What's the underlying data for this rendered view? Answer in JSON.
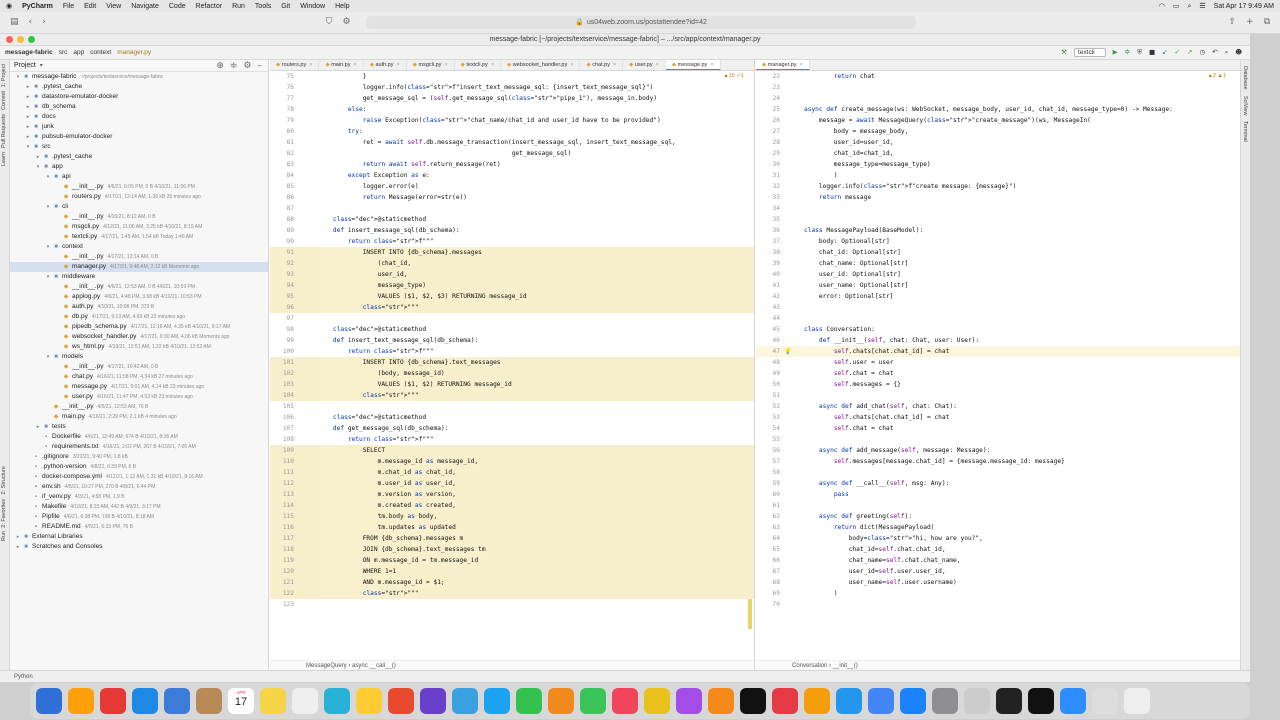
{
  "macmenu": {
    "app": "PyCharm",
    "items": [
      "File",
      "Edit",
      "View",
      "Navigate",
      "Code",
      "Refactor",
      "Run",
      "Tools",
      "Git",
      "Window",
      "Help"
    ],
    "datetime": "Sat Apr 17  9:49 AM"
  },
  "browser": {
    "url": "us04web.zoom.us/postattendee?id=42"
  },
  "ide": {
    "title": "message-fabric [~/projects/textservice/message-fabric] – .../src/app/context/manager.py",
    "nav": [
      "message-fabric",
      "src",
      "app",
      "context",
      "manager.py"
    ],
    "run_config": "textcli"
  },
  "left_strip": [
    "1: Project",
    "Commit",
    "Pull Requests",
    "Learn"
  ],
  "left_strip_bottom": [
    "2: Structure",
    "2: Favorites",
    "Run"
  ],
  "right_strip": [
    "Database",
    "SciView",
    "Terminal"
  ],
  "project": {
    "header": "Project",
    "tree": [
      {
        "d": 0,
        "t": "dir",
        "open": true,
        "name": "message-fabric",
        "meta": "~/projects/textservice/message-fabric"
      },
      {
        "d": 1,
        "t": "dir",
        "name": ".pytest_cache"
      },
      {
        "d": 1,
        "t": "dir",
        "name": "datastore-emulator-docker"
      },
      {
        "d": 1,
        "t": "dir",
        "name": "db_schema"
      },
      {
        "d": 1,
        "t": "dir",
        "name": "docs"
      },
      {
        "d": 1,
        "t": "dir",
        "name": "junk"
      },
      {
        "d": 1,
        "t": "dir",
        "name": "pubsub-emulator-docker"
      },
      {
        "d": 1,
        "t": "dir",
        "open": true,
        "name": "src"
      },
      {
        "d": 2,
        "t": "dir",
        "name": ".pytest_cache"
      },
      {
        "d": 2,
        "t": "dir",
        "open": true,
        "name": "app"
      },
      {
        "d": 3,
        "t": "dir",
        "open": true,
        "name": "api"
      },
      {
        "d": 4,
        "t": "py",
        "name": "__init__.py",
        "meta": "4/6/21, 6:05 PM, 0 B 4/10/21, 11:06 PM"
      },
      {
        "d": 4,
        "t": "py",
        "name": "routers.py",
        "meta": "4/17/21, 12:14 AM, 1.36 kB 25 minutes ago"
      },
      {
        "d": 3,
        "t": "dir",
        "open": true,
        "name": "cli"
      },
      {
        "d": 4,
        "t": "py",
        "name": "__init__.py",
        "meta": "4/10/21, 8:12 AM, 0 B"
      },
      {
        "d": 4,
        "t": "py",
        "name": "msgcli.py",
        "meta": "4/12/21, 11:06 AM, 3.25 kB 4/10/21, 8:19 AM"
      },
      {
        "d": 4,
        "t": "py",
        "name": "textcli.py",
        "meta": "4/17/21, 1:45 AM, 1.54 kB Today 1:46 AM"
      },
      {
        "d": 3,
        "t": "dir",
        "open": true,
        "name": "context"
      },
      {
        "d": 4,
        "t": "py",
        "name": "__init__.py",
        "meta": "4/17/21, 12:14 AM, 0 B"
      },
      {
        "d": 4,
        "t": "py",
        "name": "manager.py",
        "meta": "4/17/21, 9:48 AM, 2.12 kB Moments ago",
        "sel": true
      },
      {
        "d": 3,
        "t": "dir",
        "open": true,
        "name": "middleware"
      },
      {
        "d": 4,
        "t": "py",
        "name": "__init__.py",
        "meta": "4/6/21, 12:53 AM, 0 B 4/6/21, 10:59 PM"
      },
      {
        "d": 4,
        "t": "py",
        "name": "applog.py",
        "meta": "4/6/21, 4:48 PM, 3.68 kB 4/10/21, 10:53 PM"
      },
      {
        "d": 4,
        "t": "py",
        "name": "auth.py",
        "meta": "4/10/21, 10:08 PM, 373 B"
      },
      {
        "d": 4,
        "t": "py",
        "name": "db.py",
        "meta": "4/17/21, 9:13 AM, 4.69 kB 23 minutes ago"
      },
      {
        "d": 4,
        "t": "py",
        "name": "pipedb_schema.py",
        "meta": "4/17/21, 12:16 AM, 4.35 kB 4/10/21, 9:17 AM"
      },
      {
        "d": 4,
        "t": "py",
        "name": "websocket_handler.py",
        "meta": "4/17/21, 9:30 AM, 4.06 kB Moments ago"
      },
      {
        "d": 4,
        "t": "py",
        "name": "ws_html.py",
        "meta": "4/10/21, 12:51 AM, 1.22 kB 4/10/21, 12:52 AM"
      },
      {
        "d": 3,
        "t": "dir",
        "open": true,
        "name": "models"
      },
      {
        "d": 4,
        "t": "py",
        "name": "__init__.py",
        "meta": "4/17/21, 10:42 AM, 0 B"
      },
      {
        "d": 4,
        "t": "py",
        "name": "chat.py",
        "meta": "4/16/21, 11:58 PM, 4.34 kB 27 minutes ago"
      },
      {
        "d": 4,
        "t": "py",
        "name": "message.py",
        "meta": "4/17/21, 9:01 AM, 4.14 kB 23 minutes ago"
      },
      {
        "d": 4,
        "t": "py",
        "name": "user.py",
        "meta": "4/16/21, 11:47 PM, 4.53 kB 23 minutes ago"
      },
      {
        "d": 3,
        "t": "py",
        "name": "__init__.py",
        "meta": "4/5/21, 12:53 AM, 76 B"
      },
      {
        "d": 3,
        "t": "py",
        "name": "main.py",
        "meta": "4/16/21, 2:29 PM, 2.1 kB 4 minutes ago"
      },
      {
        "d": 2,
        "t": "dir",
        "name": "tests"
      },
      {
        "d": 2,
        "t": "gen",
        "name": "Dockerfile",
        "meta": "4/6/21, 12:49 AM, 674 B 4/10/21, 8:16 AM"
      },
      {
        "d": 2,
        "t": "gen",
        "name": "requirements.txt",
        "meta": "4/16/21, 2:02 PM, 267 B 4/10/21, 7:06 AM"
      },
      {
        "d": 1,
        "t": "gen",
        "name": ".gitignore",
        "meta": "3/22/21, 9:40 PM, 1.8 kB"
      },
      {
        "d": 1,
        "t": "gen",
        "name": ".python-version",
        "meta": "4/8/21, 6:39 PM, 6 B"
      },
      {
        "d": 1,
        "t": "gen",
        "name": "docker-compose.yml",
        "meta": "4/12/21, 1:12 AM, 1.31 kB 4/10/21, 8:16 AM"
      },
      {
        "d": 1,
        "t": "gen",
        "name": "env.sh",
        "meta": "4/5/21, 10:27 PM, 270 B 4/8/21, 6:44 PM"
      },
      {
        "d": 1,
        "t": "gen",
        "name": "if_venv.py",
        "meta": "4/3/21, 4:58 PM, 1.9 B"
      },
      {
        "d": 1,
        "t": "gen",
        "name": "Makefile",
        "meta": "4/10/21, 8:23 AM, 442 B 4/9/21, 3:17 PM"
      },
      {
        "d": 1,
        "t": "gen",
        "name": "Pipfile",
        "meta": "4/6/21, 6:38 PM, 198 B 4/10/21, 8:18 AM"
      },
      {
        "d": 1,
        "t": "gen",
        "name": "README.md",
        "meta": "4/5/21, 6:33 PM, 76 B"
      },
      {
        "d": 0,
        "t": "dir",
        "name": "External Libraries"
      },
      {
        "d": 0,
        "t": "dir",
        "name": "Scratches and Consoles"
      }
    ]
  },
  "editor_left": {
    "tabs": [
      "routers.py",
      "main.py",
      "auth.py",
      "msgcli.py",
      "textcli.py",
      "websocket_handler.py",
      "chat.py",
      "user.py",
      "message.py"
    ],
    "active_tab": 8,
    "inspection": "▲15 ✓1",
    "breadcrumb": "MessageQuery  ›  async __call__()",
    "lines": [
      {
        "n": 75,
        "c": "            }"
      },
      {
        "n": 76,
        "c": "            logger.info(f\"insert_text_message_sql: {insert_text_message_sql}\")"
      },
      {
        "n": 77,
        "c": "            get_message_sql = (self.get_message_sql(\"pipe_1\"), message_in.body)"
      },
      {
        "n": 78,
        "c": "        else:"
      },
      {
        "n": 79,
        "c": "            raise Exception(\"chat_name/chat_id and user_id have to be provided\")"
      },
      {
        "n": 80,
        "c": "        try:"
      },
      {
        "n": 81,
        "c": "            ret = await self.db.message_transaction(insert_message_sql, insert_text_message_sql,"
      },
      {
        "n": 82,
        "c": "                                                    get_message_sql)"
      },
      {
        "n": 83,
        "c": "            return await self.return_message(ret)"
      },
      {
        "n": 84,
        "c": "        except Exception as e:"
      },
      {
        "n": 85,
        "c": "            logger.error(e)"
      },
      {
        "n": 86,
        "c": "            return Message(error=str(e))"
      },
      {
        "n": 87,
        "c": ""
      },
      {
        "n": 88,
        "c": "    @staticmethod"
      },
      {
        "n": 89,
        "c": "    def insert_message_sql(db_schema):"
      },
      {
        "n": 90,
        "c": "        return f\"\"\""
      },
      {
        "n": 91,
        "c": "            INSERT INTO {db_schema}.messages",
        "h": 1
      },
      {
        "n": 92,
        "c": "                (chat_id,",
        "h": 1
      },
      {
        "n": 93,
        "c": "                user_id,",
        "h": 1
      },
      {
        "n": 94,
        "c": "                message_type)",
        "h": 1
      },
      {
        "n": 95,
        "c": "                VALUES ($1, $2, $3) RETURNING message_id",
        "h": 1
      },
      {
        "n": 96,
        "c": "            \"\"\"",
        "h": 1
      },
      {
        "n": 97,
        "c": ""
      },
      {
        "n": 98,
        "c": "    @staticmethod"
      },
      {
        "n": 99,
        "c": "    def insert_text_message_sql(db_schema):"
      },
      {
        "n": 100,
        "c": "        return f\"\"\""
      },
      {
        "n": 101,
        "c": "            INSERT INTO {db_schema}.text_messages",
        "h": 1
      },
      {
        "n": 102,
        "c": "                (body, message_id)",
        "h": 1
      },
      {
        "n": 103,
        "c": "                VALUES ($1, $2) RETURNING message_id",
        "h": 1
      },
      {
        "n": 104,
        "c": "            \"\"\"",
        "h": 1
      },
      {
        "n": 105,
        "c": ""
      },
      {
        "n": 106,
        "c": "    @staticmethod"
      },
      {
        "n": 107,
        "c": "    def get_message_sql(db_schema):"
      },
      {
        "n": 108,
        "c": "        return f\"\"\""
      },
      {
        "n": 109,
        "c": "            SELECT",
        "h": 1
      },
      {
        "n": 110,
        "c": "                m.message_id as message_id,",
        "h": 1
      },
      {
        "n": 111,
        "c": "                m.chat_id as chat_id,",
        "h": 1
      },
      {
        "n": 112,
        "c": "                m.user_id as user_id,",
        "h": 1
      },
      {
        "n": 113,
        "c": "                m.version as version,",
        "h": 1
      },
      {
        "n": 114,
        "c": "                m.created as created,",
        "h": 1
      },
      {
        "n": 115,
        "c": "                tm.body as body,",
        "h": 1
      },
      {
        "n": 116,
        "c": "                tm.updates as updated",
        "h": 1
      },
      {
        "n": 117,
        "c": "            FROM {db_schema}.messages m",
        "h": 1
      },
      {
        "n": 118,
        "c": "            JOIN {db_schema}.text_messages tm",
        "h": 1
      },
      {
        "n": 119,
        "c": "            ON m.message_id = tm.message_id",
        "h": 1
      },
      {
        "n": 120,
        "c": "            WHERE 1=1",
        "h": 1
      },
      {
        "n": 121,
        "c": "            AND m.message_id = $1;",
        "h": 1
      },
      {
        "n": 122,
        "c": "            \"\"\"",
        "h": 1
      },
      {
        "n": 123,
        "c": ""
      }
    ]
  },
  "editor_right": {
    "tabs": [
      "manager.py"
    ],
    "inspection": "▲2 ▲1",
    "breadcrumb": "Conversation  ›  __init__()",
    "lines": [
      {
        "n": 22,
        "c": "        return chat"
      },
      {
        "n": 23,
        "c": ""
      },
      {
        "n": 24,
        "c": ""
      },
      {
        "n": 25,
        "c": "async def create_message(ws: WebSocket, message_body, user_id, chat_id, message_type=0) -> Message:"
      },
      {
        "n": 26,
        "c": "    message = await MessageQuery(\"create_message\")(ws, MessageIn("
      },
      {
        "n": 27,
        "c": "        body = message_body,"
      },
      {
        "n": 28,
        "c": "        user_id=user_id,"
      },
      {
        "n": 29,
        "c": "        chat_id=chat_id,"
      },
      {
        "n": 30,
        "c": "        message_type=message_type)"
      },
      {
        "n": 31,
        "c": "        )"
      },
      {
        "n": 32,
        "c": "    logger.info(f\"create message: {message}\")"
      },
      {
        "n": 33,
        "c": "    return message"
      },
      {
        "n": 34,
        "c": ""
      },
      {
        "n": 35,
        "c": ""
      },
      {
        "n": 36,
        "c": "class MessagePayload(BaseModel):"
      },
      {
        "n": 37,
        "c": "    body: Optional[str]"
      },
      {
        "n": 38,
        "c": "    chat_id: Optional[str]"
      },
      {
        "n": 39,
        "c": "    chat_name: Optional[str]"
      },
      {
        "n": 40,
        "c": "    user_id: Optional[str]"
      },
      {
        "n": 41,
        "c": "    user_name: Optional[str]"
      },
      {
        "n": 42,
        "c": "    error: Optional[str]"
      },
      {
        "n": 43,
        "c": ""
      },
      {
        "n": 44,
        "c": ""
      },
      {
        "n": 45,
        "c": "class Conversation:"
      },
      {
        "n": 46,
        "c": "    def __init__(self, chat: Chat, user: User):"
      },
      {
        "n": 47,
        "c": "        self.chats[chat.chat_id] = chat",
        "cur": 1
      },
      {
        "n": 48,
        "c": "        self.user = user"
      },
      {
        "n": 49,
        "c": "        self.chat = chat"
      },
      {
        "n": 50,
        "c": "        self.messages = {}"
      },
      {
        "n": 51,
        "c": ""
      },
      {
        "n": 52,
        "c": "    async def add_chat(self, chat: Chat):"
      },
      {
        "n": 53,
        "c": "        self.chats[chat.chat_id] = chat"
      },
      {
        "n": 54,
        "c": "        self.chat = chat"
      },
      {
        "n": 55,
        "c": ""
      },
      {
        "n": 56,
        "c": "    async def add_message(self, message: Message):"
      },
      {
        "n": 57,
        "c": "        self.messages[message.chat_id] = {message.message_id: message}"
      },
      {
        "n": 58,
        "c": ""
      },
      {
        "n": 59,
        "c": "    async def __call__(self, msg: Any):"
      },
      {
        "n": 60,
        "c": "        pass"
      },
      {
        "n": 61,
        "c": ""
      },
      {
        "n": 62,
        "c": "    async def greeting(self):"
      },
      {
        "n": 63,
        "c": "        return dict(MessagePayload("
      },
      {
        "n": 64,
        "c": "            body=\"hi, how are you?\","
      },
      {
        "n": 65,
        "c": "            chat_id=self.chat.chat_id,"
      },
      {
        "n": 66,
        "c": "            chat_name=self.chat.chat_name,"
      },
      {
        "n": 67,
        "c": "            user_id=self.user.user_id,"
      },
      {
        "n": 68,
        "c": "            user_name=self.user.username)"
      },
      {
        "n": 69,
        "c": "        )"
      },
      {
        "n": 70,
        "c": ""
      }
    ]
  },
  "statusbar": {
    "text": "Python"
  },
  "dock": {
    "date_month": "APR",
    "date_day": "17",
    "colors": [
      "#2f6fd6",
      "#ff9f0a",
      "#e53935",
      "#1e88e5",
      "#3d7bd8",
      "#b88a57",
      "#ffffff",
      "#f5d547",
      "#efefef",
      "#27b2d6",
      "#ffcc33",
      "#e84a2f",
      "#6a3fc9",
      "#3aa0e0",
      "#1ba3f2",
      "#33c24d",
      "#f08a1c",
      "#3ac45a",
      "#f0455a",
      "#e9c11c",
      "#a34de6",
      "#f58a1a",
      "#111111",
      "#e63946",
      "#f59e0b",
      "#2496ed",
      "#4285f4",
      "#1a82fb",
      "#8e8e93",
      "#cccccc",
      "#222222",
      "#111111",
      "#2d8cff",
      "#dddddd",
      "#eeeeee"
    ]
  }
}
